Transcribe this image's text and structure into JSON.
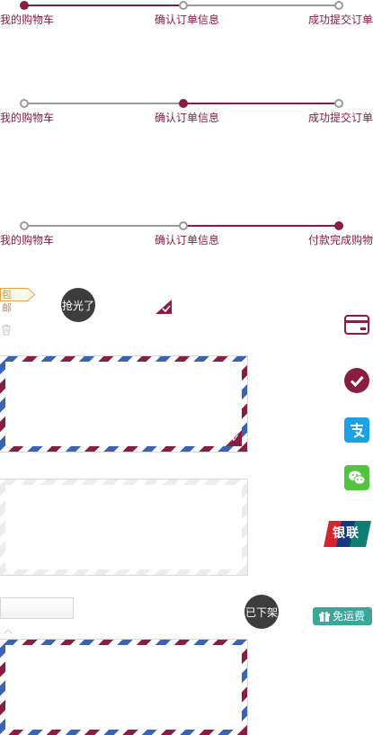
{
  "steppers": [
    {
      "labels": [
        "我的购物车",
        "确认订单信息",
        "成功提交订单"
      ]
    },
    {
      "labels": [
        "我的购物车",
        "确认订单信息",
        "成功提交订单"
      ]
    },
    {
      "labels": [
        "我的购物车",
        "确认订单信息",
        "付款完成购物"
      ]
    }
  ],
  "tags": {
    "free_shipping": "包邮",
    "sold_out": "抢光了",
    "off_shelf": "已下架",
    "free_freight": "免运费"
  },
  "icons": {
    "trash": "trash-icon",
    "card": "credit-card-icon",
    "check": "check-circle-icon",
    "alipay": "alipay-icon",
    "wechat": "wechat-pay-icon",
    "unionpay": "unionpay-icon"
  },
  "unionpay_text": "银联",
  "colors": {
    "brand": "#8a1d43",
    "airmail_blue": "#3a63b5",
    "alipay": "#1aa1e8",
    "wechat": "#54c33f",
    "badge_dark": "#3d3d3d",
    "free_freight": "#3aa79a",
    "free_shipping_border": "#e8a34a"
  }
}
